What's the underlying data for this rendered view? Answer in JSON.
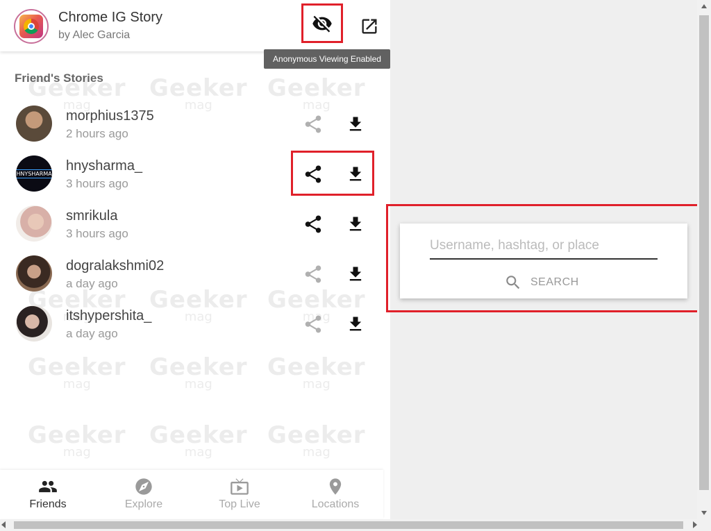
{
  "header": {
    "app_title": "Chrome IG Story",
    "app_author": "by Alec Garcia",
    "anon_icon": "eye-off-icon",
    "open_icon": "open-in-new-icon",
    "tooltip": "Anonymous Viewing Enabled"
  },
  "friends_section": {
    "title": "Friend's Stories",
    "stories": [
      {
        "username": "morphius1375",
        "time": "2 hours ago",
        "share_active": false
      },
      {
        "username": "hnysharma_",
        "time": "3 hours ago",
        "share_active": true,
        "avatar_text": "HNYSHARMA"
      },
      {
        "username": "smrikula",
        "time": "3 hours ago",
        "share_active": true
      },
      {
        "username": "dogralakshmi02",
        "time": "a day ago",
        "share_active": false
      },
      {
        "username": "itshypershita_",
        "time": "a day ago",
        "share_active": false
      }
    ]
  },
  "bottom_nav": {
    "items": [
      {
        "label": "Friends",
        "icon": "people-icon",
        "active": true
      },
      {
        "label": "Explore",
        "icon": "compass-icon",
        "active": false
      },
      {
        "label": "Top Live",
        "icon": "live-tv-icon",
        "active": false
      },
      {
        "label": "Locations",
        "icon": "location-pin-icon",
        "active": false
      }
    ]
  },
  "search": {
    "placeholder": "Username, hashtag, or place",
    "value": "",
    "button_label": "SEARCH"
  },
  "colors": {
    "highlight": "#e0202a",
    "icon_active": "#111111",
    "icon_inactive": "#b0b0b0",
    "right_bg": "#efefef"
  }
}
